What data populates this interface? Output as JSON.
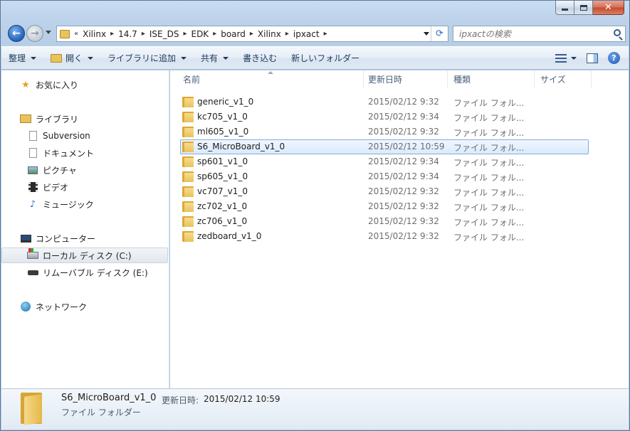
{
  "window": {
    "caption_buttons": [
      "minimize",
      "maximize",
      "close"
    ],
    "accent": "#3399ff"
  },
  "address": {
    "prefix": "«",
    "crumbs": [
      "Xilinx",
      "14.7",
      "ISE_DS",
      "EDK",
      "board",
      "Xilinx",
      "ipxact"
    ]
  },
  "search": {
    "placeholder": "ipxactの検索"
  },
  "toolbar": {
    "organize": "整理",
    "open": "開く",
    "include_library": "ライブラリに追加",
    "share": "共有",
    "burn": "書き込む",
    "new_folder": "新しいフォルダー"
  },
  "nav": {
    "favorites": "お気に入り",
    "libraries": "ライブラリ",
    "lib_items": [
      "Subversion",
      "ドキュメント",
      "ピクチャ",
      "ビデオ",
      "ミュージック"
    ],
    "computer": "コンピューター",
    "local_disk": "ローカル ディスク (C:)",
    "removable": "リムーバブル ディスク (E:)",
    "network": "ネットワーク"
  },
  "columns": {
    "name": "名前",
    "date": "更新日時",
    "type": "種類",
    "size": "サイズ"
  },
  "files": [
    {
      "name": "generic_v1_0",
      "date": "2015/02/12 9:32",
      "type": "ファイル フォル..."
    },
    {
      "name": "kc705_v1_0",
      "date": "2015/02/12 9:34",
      "type": "ファイル フォル..."
    },
    {
      "name": "ml605_v1_0",
      "date": "2015/02/12 9:32",
      "type": "ファイル フォル..."
    },
    {
      "name": "S6_MicroBoard_v1_0",
      "date": "2015/02/12 10:59",
      "type": "ファイル フォル..."
    },
    {
      "name": "sp601_v1_0",
      "date": "2015/02/12 9:34",
      "type": "ファイル フォル..."
    },
    {
      "name": "sp605_v1_0",
      "date": "2015/02/12 9:34",
      "type": "ファイル フォル..."
    },
    {
      "name": "vc707_v1_0",
      "date": "2015/02/12 9:32",
      "type": "ファイル フォル..."
    },
    {
      "name": "zc702_v1_0",
      "date": "2015/02/12 9:32",
      "type": "ファイル フォル..."
    },
    {
      "name": "zc706_v1_0",
      "date": "2015/02/12 9:32",
      "type": "ファイル フォル..."
    },
    {
      "name": "zedboard_v1_0",
      "date": "2015/02/12 9:32",
      "type": "ファイル フォル..."
    }
  ],
  "details": {
    "name": "S6_MicroBoard_v1_0",
    "date_label": "更新日時:",
    "date": "2015/02/12 10:59",
    "type": "ファイル フォルダー"
  }
}
